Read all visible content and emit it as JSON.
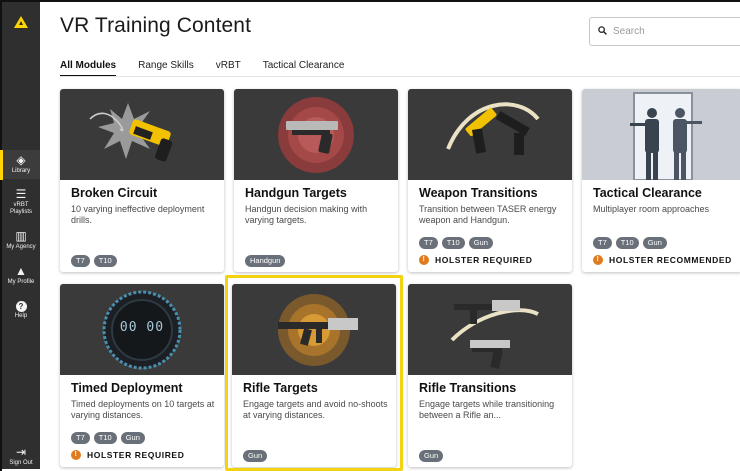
{
  "colors": {
    "accent": "#ffd400",
    "sidebar_bg": "#2f2f2f",
    "tag_bg": "#6a7079",
    "holster_dot": "#e07b1f",
    "selection": "#f3d20f"
  },
  "sidebar": {
    "logo_icon": "yellow-triangle-logo-icon",
    "items": [
      {
        "label": "Library",
        "icon": "layers-icon",
        "glyph": "◈"
      },
      {
        "label": "vRBT Playlists",
        "icon": "playlist-icon",
        "glyph": "☰"
      },
      {
        "label": "My Agency",
        "icon": "building-icon",
        "glyph": "▥"
      },
      {
        "label": "My Profile",
        "icon": "person-icon",
        "glyph": "▲"
      },
      {
        "label": "Help",
        "icon": "help-icon",
        "glyph": "?"
      },
      {
        "label": "Sign Out",
        "icon": "sign-out-icon",
        "glyph": "⇥"
      }
    ]
  },
  "header": {
    "title": "VR Training Content",
    "search": {
      "placeholder": "Search",
      "value": "",
      "icon": "search-icon"
    }
  },
  "tabs": [
    {
      "label": "All Modules",
      "active": true
    },
    {
      "label": "Range Skills",
      "active": false
    },
    {
      "label": "vRBT",
      "active": false
    },
    {
      "label": "Tactical Clearance",
      "active": false
    }
  ],
  "cards": [
    {
      "title": "Broken Circuit",
      "description": "10 varying ineffective deployment drills.",
      "tags": [
        "T7",
        "T10"
      ],
      "holster": "",
      "image": "broken-taser-illustration"
    },
    {
      "title": "Handgun Targets",
      "description": "Handgun decision making with varying targets.",
      "tags": [
        "Handgun"
      ],
      "holster": "",
      "image": "handgun-target-illustration"
    },
    {
      "title": "Weapon Transitions",
      "description": "Transition between TASER energy weapon and Handgun.",
      "tags": [
        "T7",
        "T10",
        "Gun"
      ],
      "holster": "HOLSTER REQUIRED",
      "image": "taser-and-handgun-illustration"
    },
    {
      "title": "Tactical Clearance",
      "description": "Multiplayer room approaches",
      "tags": [
        "T7",
        "T10",
        "Gun"
      ],
      "holster": "HOLSTER RECOMMENDED",
      "image": "officers-doorway-illustration"
    },
    {
      "title": "Timed Deployment",
      "description": "Timed deployments on 10 targets at varying distances.",
      "tags": [
        "T7",
        "T10",
        "Gun"
      ],
      "holster": "HOLSTER REQUIRED",
      "image": "digital-timer-illustration",
      "timer": "00 00"
    },
    {
      "title": "Rifle Targets",
      "description": "Engage targets and avoid no-shoots at varying distances.",
      "tags": [
        "Gun"
      ],
      "holster": "",
      "image": "rifle-target-illustration",
      "selected": true
    },
    {
      "title": "Rifle Transitions",
      "description": "Engage targets while transitioning between a Rifle an...",
      "tags": [
        "Gun"
      ],
      "holster": "",
      "image": "rifle-and-handgun-illustration"
    }
  ]
}
